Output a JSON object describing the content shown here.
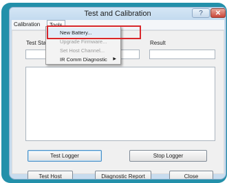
{
  "window": {
    "title": "Test and Calibration",
    "help_button": "?",
    "close_button": "✕"
  },
  "menubar": {
    "items": [
      "Calibration",
      "Tools"
    ]
  },
  "tools_menu": {
    "items": [
      {
        "label": "New Battery...",
        "enabled": true,
        "highlighted": true
      },
      {
        "label": "Upgrade Firmware...",
        "enabled": false
      },
      {
        "label": "Set Host Channel...",
        "enabled": false
      },
      {
        "label": "IR Comm Diagnostic",
        "enabled": true,
        "submenu": true
      }
    ],
    "submenu_arrow": "▶"
  },
  "form": {
    "test_status_label": "Test Sta",
    "result_label": "Result",
    "test_status_value": "",
    "result_value": ""
  },
  "buttons": {
    "test_logger": "Test Logger",
    "stop_logger": "Stop Logger",
    "test_host": "Test Host",
    "diagnostic_report": "Diagnostic Report",
    "close": "Close"
  },
  "colors": {
    "frame": "#2390aa",
    "highlight_box": "#d8262a"
  }
}
